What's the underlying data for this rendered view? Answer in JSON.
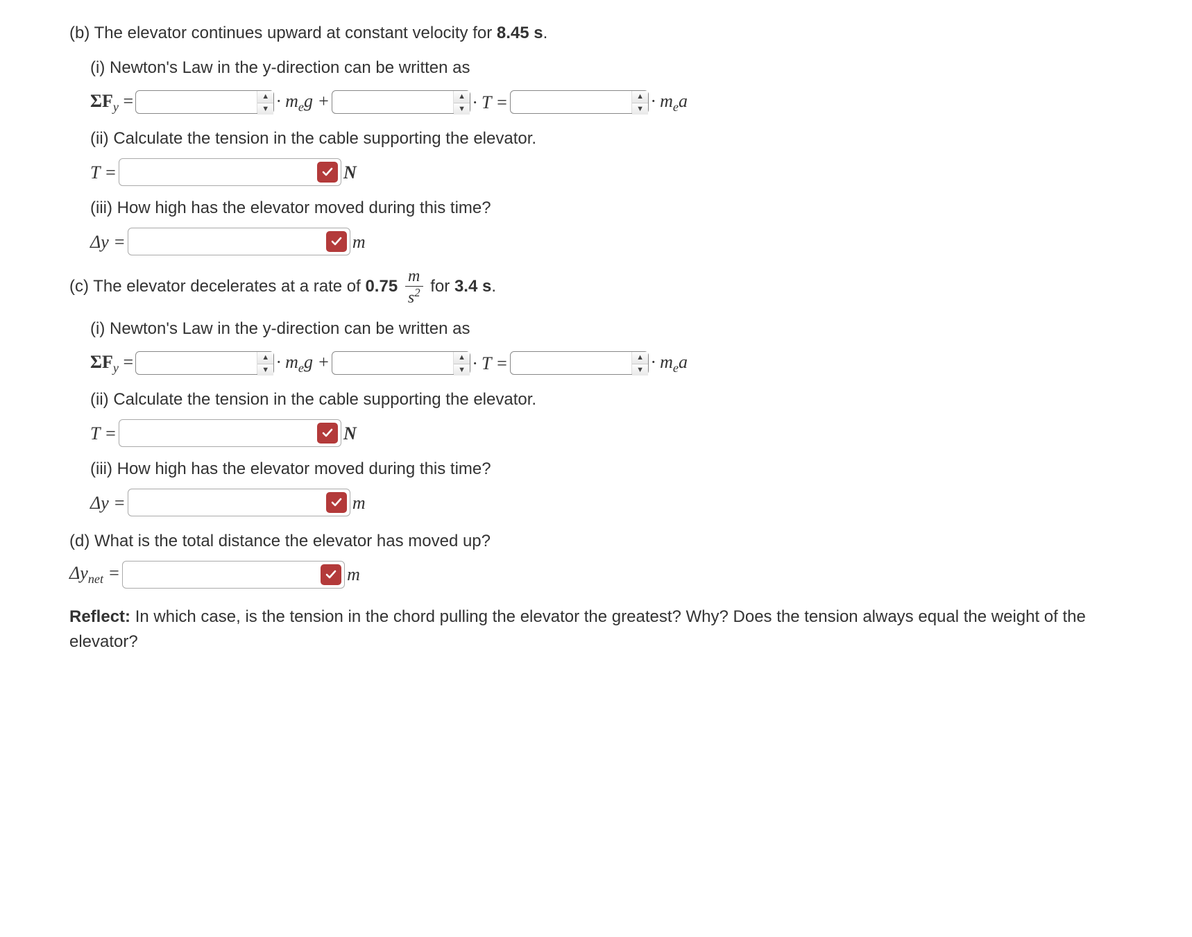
{
  "b": {
    "prompt": {
      "prefix": "(b) The elevator continues upward at constant velocity for ",
      "value": "8.45 s",
      "suffix": "."
    },
    "i": {
      "text": "(i) Newton's Law in the y-direction can be written as",
      "eq": {
        "lhs_html": "ΣF",
        "lhs_sub": "y",
        "eq1": "=",
        "after1_html": "· m",
        "after1_sub": "e",
        "after1_tail": "g +",
        "after2": "· T =",
        "after3_html": "· m",
        "after3_sub": "e",
        "after3_tail": "a"
      }
    },
    "ii": {
      "text": "(ii) Calculate the tension in the cable supporting the elevator.",
      "lhs": "T =",
      "value": "",
      "unit": "N"
    },
    "iii": {
      "text": "(iii) How high has the elevator moved during this time?",
      "lhs": "Δy =",
      "value": "",
      "unit": "m"
    }
  },
  "c": {
    "prompt": {
      "prefix": "(c) The elevator decelerates at a rate of ",
      "rate": "0.75",
      "frac_num": "m",
      "frac_den_base": "s",
      "frac_den_exp": "2",
      "mid": " for ",
      "time": "3.4 s",
      "suffix": "."
    },
    "i": {
      "text": "(i) Newton's Law in the y-direction can be written as",
      "eq": {
        "lhs_html": "ΣF",
        "lhs_sub": "y",
        "eq1": "=",
        "after1_html": "· m",
        "after1_sub": "e",
        "after1_tail": "g +",
        "after2": "· T =",
        "after3_html": "· m",
        "after3_sub": "e",
        "after3_tail": "a"
      }
    },
    "ii": {
      "text": "(ii) Calculate the tension in the cable supporting the elevator.",
      "lhs": "T =",
      "value": "",
      "unit": "N"
    },
    "iii": {
      "text": "(iii) How high has the elevator moved during this time?",
      "lhs": "Δy =",
      "value": "",
      "unit": "m"
    }
  },
  "d": {
    "text": "(d) What is the total distance the elevator has moved up?",
    "lhs_main": "Δy",
    "lhs_sub": "net",
    "lhs_suffix": " =",
    "value": "",
    "unit": "m"
  },
  "reflect": {
    "label": "Reflect:",
    "text": " In which case, is the tension in the chord pulling the elevator the greatest? Why? Does the tension always equal the weight of the elevator?"
  }
}
